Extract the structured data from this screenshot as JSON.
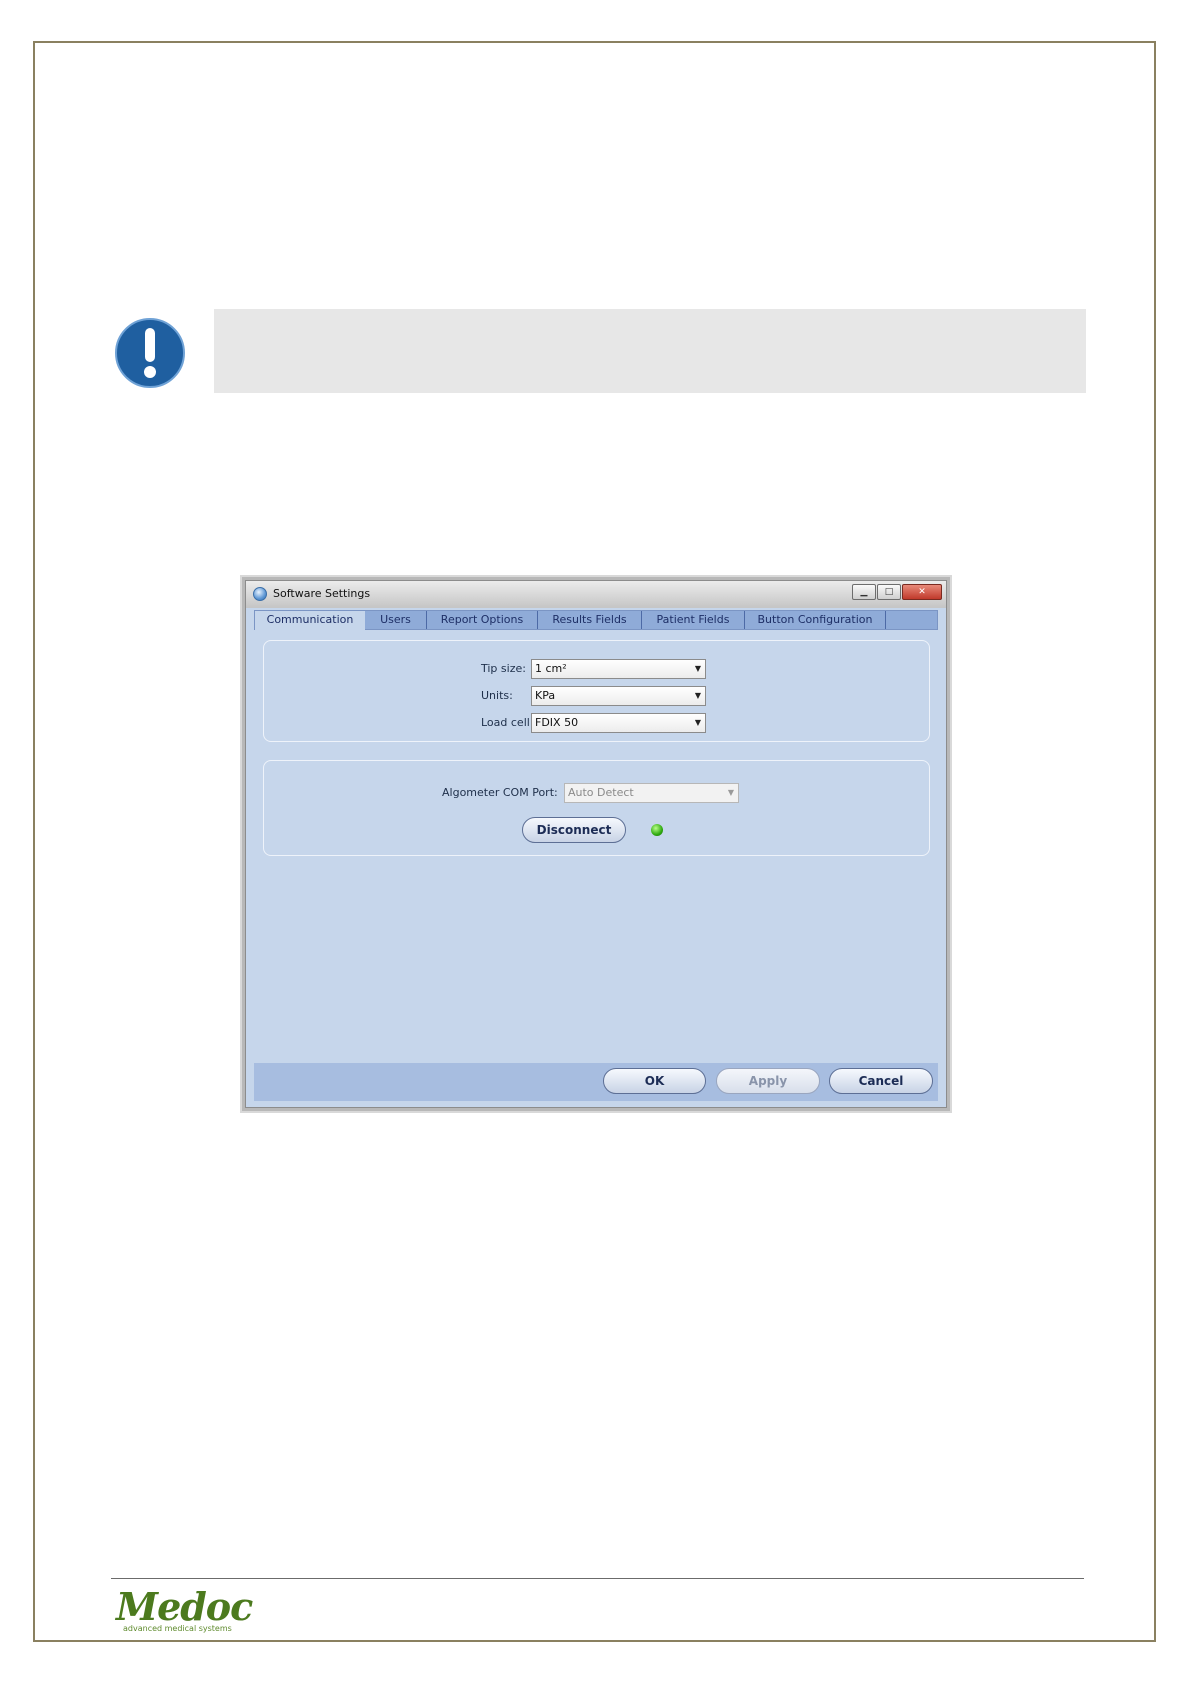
{
  "colors": {
    "page_border": "#8a8060",
    "notice_icon": "#1f5fa0",
    "dialog_background": "#c6d6eb",
    "tab_strip": "#8fabd8",
    "connected_led": "#2faa10",
    "logo": "#4c7a1e"
  },
  "notice": {
    "icon": "exclamation-icon"
  },
  "dialog": {
    "title": "Software Settings",
    "window_controls": {
      "minimize": "minimize-icon",
      "maximize": "maximize-icon",
      "close": "close-icon"
    },
    "tabs": [
      {
        "label": "Communication",
        "active": true
      },
      {
        "label": "Users"
      },
      {
        "label": "Report Options"
      },
      {
        "label": "Results Fields"
      },
      {
        "label": "Patient Fields"
      },
      {
        "label": "Button Configuration"
      }
    ],
    "device": {
      "tip_size_label": "Tip size:",
      "tip_size_value": "1 cm²",
      "units_label": "Units:",
      "units_value": "KPa",
      "load_cell_label": "Load cell",
      "load_cell_value": "FDIX 50"
    },
    "connection": {
      "com_port_label": "Algometer COM Port:",
      "com_port_value": "Auto Detect",
      "disconnect_label": "Disconnect",
      "status": "connected"
    },
    "buttons": {
      "ok": "OK",
      "apply": "Apply",
      "cancel": "Cancel"
    }
  },
  "footer": {
    "logo_text": "Medoc",
    "logo_tagline": "advanced medical systems"
  }
}
